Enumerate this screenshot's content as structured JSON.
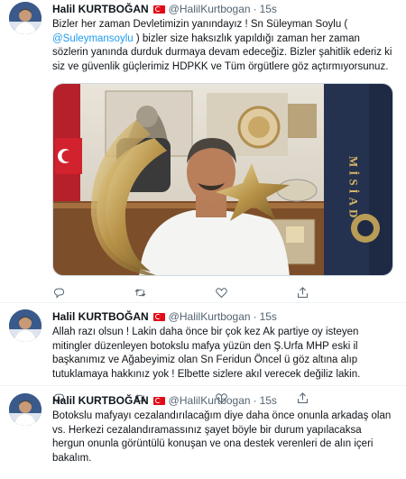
{
  "tweets": [
    {
      "author_name": "Halil KURTBOĞAN",
      "handle": "@HalilKurtbogan",
      "separator": "·",
      "time": "15s",
      "text_before": "Bizler her zaman Devletimizin yanındayız ! Sn Süleyman Soylu (",
      "mention": "@Suleymansoylu",
      "text_after": ") bizler size haksızlık yapıldığı zaman her zaman sözlerin yanında durduk durmaya devam edeceğiz. Bizler şahitlik ederiz ki siz ve güvenlik güçlerimiz HDPKK ve Tüm örgütlere göz açtırmıyorsunuz.",
      "image_text": "MİSİAD"
    },
    {
      "author_name": "Halil KURTBOĞAN",
      "handle": "@HalilKurtbogan",
      "separator": "·",
      "time": "15s",
      "text": "Allah razı olsun ! Lakin daha önce bir çok kez Ak partiye oy isteyen mitingler düzenleyen botokslu mafya yüzün den Ş.Urfa MHP eski il başkanımız ve Ağabeyimiz olan Sn Feridun Öncel ü göz altına alıp tutuklamaya hakkınız yok ! Elbette sizlere akıl verecek değiliz lakin."
    },
    {
      "author_name": "Halil KURTBOĞAN",
      "handle": "@HalilKurtbogan",
      "separator": "·",
      "time": "15s",
      "text": "Botokslu mafyayı cezalandırılacağım diye daha önce onunla arkadaş olan vs. Herkezi cezalandıramassınız şayet böyle bir durum yapılacaksa hergun onunla görüntülü konuşan ve ona destek verenleri de alın içeri bakalım."
    }
  ],
  "icons": [
    "reply-icon",
    "retweet-icon",
    "like-icon",
    "share-icon"
  ],
  "colors": {
    "link": "#1d9bf0",
    "muted": "#536471",
    "flag": "#e30a17"
  }
}
